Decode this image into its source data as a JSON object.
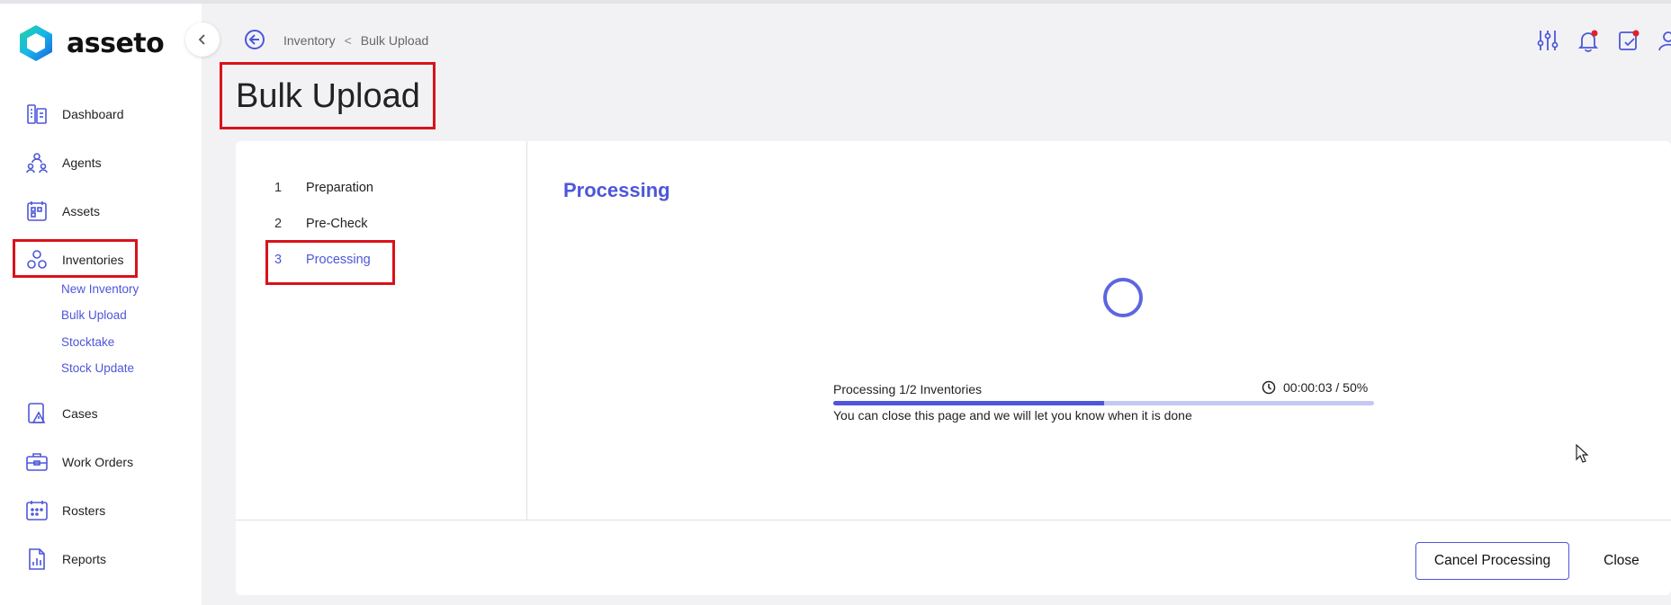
{
  "app": {
    "name": "asseto"
  },
  "sidebar": {
    "items": [
      {
        "label": "Dashboard",
        "icon": "dashboard-icon"
      },
      {
        "label": "Agents",
        "icon": "agents-icon"
      },
      {
        "label": "Assets",
        "icon": "assets-icon"
      },
      {
        "label": "Inventories",
        "icon": "inventories-icon"
      },
      {
        "label": "Cases",
        "icon": "cases-icon"
      },
      {
        "label": "Work Orders",
        "icon": "work-orders-icon"
      },
      {
        "label": "Rosters",
        "icon": "rosters-icon"
      },
      {
        "label": "Reports",
        "icon": "reports-icon"
      }
    ],
    "sub_items": [
      {
        "label": "New Inventory"
      },
      {
        "label": "Bulk Upload"
      },
      {
        "label": "Stocktake"
      },
      {
        "label": "Stock Update"
      }
    ]
  },
  "breadcrumb": {
    "parent": "Inventory",
    "separator": "<",
    "current": "Bulk Upload"
  },
  "page": {
    "title": "Bulk Upload"
  },
  "steps": [
    {
      "number": "1",
      "label": "Preparation"
    },
    {
      "number": "2",
      "label": "Pre-Check"
    },
    {
      "number": "3",
      "label": "Processing",
      "active": true
    }
  ],
  "processing": {
    "title": "Processing",
    "label": "Processing 1/2 Inventories",
    "time": "00:00:03 / 50%",
    "progress_percent": 50,
    "note": "You can close this page and we will let you know when it is done"
  },
  "buttons": {
    "cancel": "Cancel Processing",
    "close": "Close"
  },
  "colors": {
    "accent": "#4d57d8",
    "highlight": "#d9121b",
    "notification": "#e0202a"
  }
}
